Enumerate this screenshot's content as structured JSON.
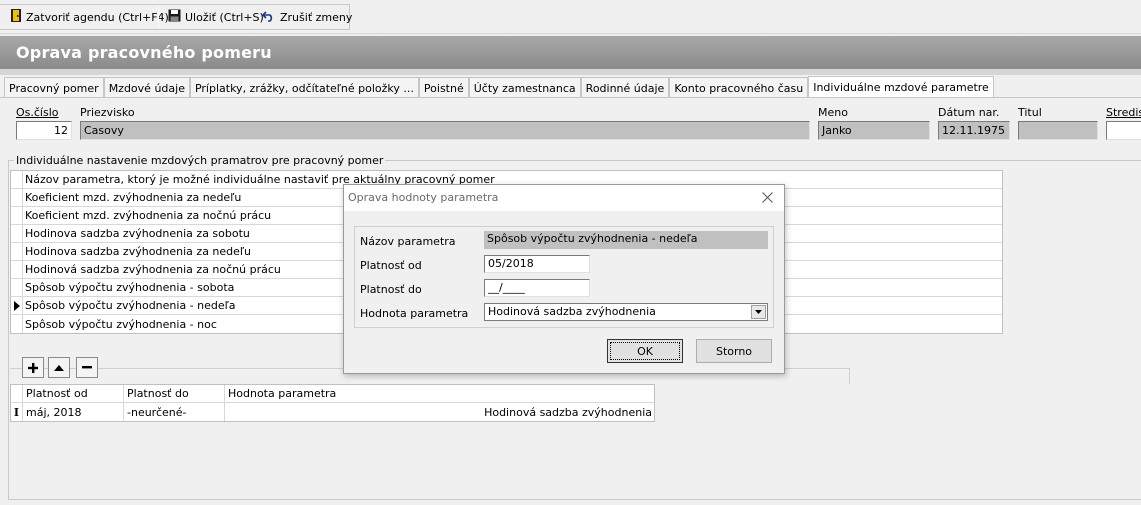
{
  "toolbar": {
    "close_label": "Zatvoriť agendu (Ctrl+F4)",
    "save_label": "Uložiť (Ctrl+S)",
    "cancel_label": "Zrušiť zmeny"
  },
  "page": {
    "title": "Oprava pracovného pomeru"
  },
  "tabs": [
    {
      "label": "Pracovný pomer"
    },
    {
      "label": "Mzdové údaje"
    },
    {
      "label": "Príplatky, zrážky, odčítateľné položky ..."
    },
    {
      "label": "Poistné"
    },
    {
      "label": "Účty zamestnanca"
    },
    {
      "label": "Rodinné údaje"
    },
    {
      "label": "Konto pracovného času"
    },
    {
      "label": "Individuálne mzdové parametre"
    }
  ],
  "employee": {
    "os_cislo_label": "Os.číslo",
    "os_cislo_value": "12",
    "priezvisko_label": "Priezvisko",
    "priezvisko_value": "Casovy",
    "meno_label": "Meno",
    "meno_value": "Janko",
    "datum_label": "Dátum nar.",
    "datum_value": "12.11.1975",
    "titul_label": "Titul",
    "titul_value": "",
    "stredisko_label": "Stredisk"
  },
  "params_group": {
    "title": "Individuálne nastavenie mzdových pramatrov pre pracovný pomer",
    "header": "Názov parametra, ktorý je možné individuálne nastaviť pre aktuálny pracovný pomer",
    "rows": [
      {
        "name": "Koeficient mzd. zvýhodnenia za nedeľu"
      },
      {
        "name": "Koeficient mzd. zvýhodnenia za nočnú prácu"
      },
      {
        "name": "Hodinova sadzba zvýhodnenia za sobotu"
      },
      {
        "name": "Hodinova sadzba zvýhodnenia za nedeľu"
      },
      {
        "name": "Hodinová sadzba zvýhodnenia za nočnú prácu"
      },
      {
        "name": "Spôsob výpočtu zvýhodnenia - sobota"
      },
      {
        "name": "Spôsob výpočtu zvýhodnenia - nedeľa"
      },
      {
        "name": "Spôsob výpočtu zvýhodnenia - noc"
      }
    ]
  },
  "values_grid": {
    "columns": [
      "Platnosť od",
      "Platnosť do",
      "Hodnota parametra"
    ],
    "rows": [
      {
        "from": "máj, 2018",
        "to": "-neurčené-",
        "value": "Hodinová sadzba zvýhodnenia"
      }
    ]
  },
  "dialog": {
    "title": "Oprava hodnoty parametra",
    "name_label": "Názov parametra",
    "name_value": "Spôsob výpočtu zvýhodnenia - nedeľa",
    "from_label": "Platnosť od",
    "from_value": "05/2018",
    "to_label": "Platnosť do",
    "to_value": "__/____",
    "value_label": "Hodnota parametra",
    "value_value": "Hodinová sadzba zvýhodnenia",
    "ok_label": "OK",
    "cancel_label": "Storno"
  }
}
